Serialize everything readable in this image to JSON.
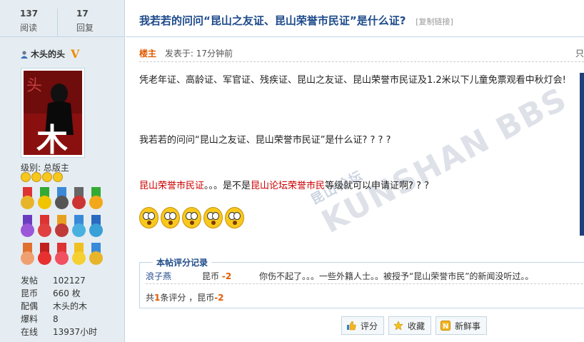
{
  "stats": {
    "views_count": "137",
    "views_label": "阅读",
    "replies_count": "17",
    "replies_label": "回复"
  },
  "author": {
    "name": "木头的头",
    "badge": "V",
    "level": "级别: 总版主",
    "info": [
      {
        "key": "发帖",
        "value": "102127"
      },
      {
        "key": "昆币",
        "value": "660 枚"
      },
      {
        "key": "配偶",
        "value": "木头的木"
      },
      {
        "key": "爆料",
        "value": "8"
      },
      {
        "key": "在线",
        "value": "13937小时"
      }
    ]
  },
  "thread": {
    "title": "我若若的问问“昆山之友证、昆山荣誉市民证”是什么证?",
    "copy_link": "[复制链接]"
  },
  "post": {
    "owner_label": "楼主",
    "posted_time": "发表于: 17分钟前",
    "right_label": "只",
    "p1": "凭老年证、高龄证、军官证、残疾证、昆山之友证、昆山荣誉市民证及1.2米以下儿童免票观看中秋灯会!",
    "p2": "我若若的问问“昆山之友证、昆山荣誉市民证”是什么证? ? ? ?",
    "p3_a": "昆山荣誉市民证",
    "p3_b": "。。。是不是",
    "p3_c": "昆山论坛荣誉市民",
    "p3_d": "等级就可以申请证啊? ? ?"
  },
  "rating": {
    "legend": "本帖评分记录",
    "rows": [
      {
        "user": "浪子燕",
        "currency": "昆币",
        "amount": "-2",
        "reason": "你伤不起了。。。一些外籍人士。。被授予“昆山荣誉市民”的新闻没听过。。"
      }
    ],
    "summary_prefix": "共",
    "summary_count": "1",
    "summary_middle": "条评分 ，昆币",
    "summary_amount": "-2"
  },
  "buttons": {
    "rate": "评分",
    "favorite": "收藏",
    "fresh": "新鲜事"
  },
  "colors": {
    "accent_blue": "#1d4a8a",
    "highlight_red": "#cc0000",
    "orange": "#e05a00",
    "sidebar_bg": "#e5edf2"
  }
}
